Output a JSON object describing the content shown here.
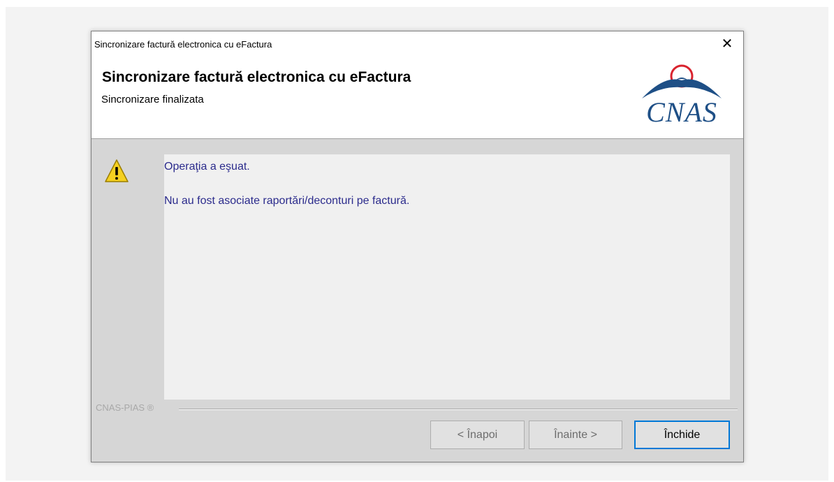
{
  "window": {
    "title": "Sincronizare factură electronica cu eFactura",
    "close_symbol": "✕"
  },
  "header": {
    "title": "Sincronizare factură electronica cu eFactura",
    "subtitle": "Sincronizare finalizata",
    "logo_text": "CNAS",
    "logo_colors": {
      "text": "#1e4f86",
      "circle": "#d9232e"
    }
  },
  "message": {
    "icon": "warning-icon",
    "line1": "Operaţia a eşuat.",
    "line2": "Nu au fost asociate raportări/deconturi pe factură."
  },
  "footer": {
    "brand": "CNAS-PIAS ®",
    "back_label": "< Înapoi",
    "next_label": "Înainte >",
    "close_label": "Închide"
  },
  "colors": {
    "message_text": "#2b2b8c",
    "dialog_bg": "#d6d6d6",
    "focus_border": "#0078d7"
  }
}
